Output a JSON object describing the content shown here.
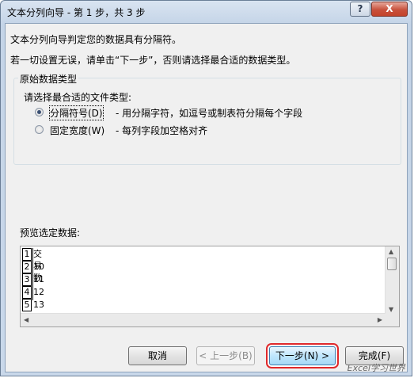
{
  "window": {
    "title": "文本分列向导 - 第 1 步，共 3 步",
    "help_label": "?",
    "close_label": "X"
  },
  "intro": {
    "line1": "文本分列向导判定您的数据具有分隔符。",
    "line2": "若一切设置无误，请单击“下一步”，否则请选择最合适的数据类型。"
  },
  "group": {
    "title": "原始数据类型",
    "prompt": "请选择最合适的文件类型:",
    "options": [
      {
        "label": "分隔符号(D)",
        "description": "- 用分隔字符，如逗号或制表符分隔每个字段",
        "checked": true
      },
      {
        "label": "固定宽度(W)",
        "description": "- 每列字段加空格对齐",
        "checked": false
      }
    ]
  },
  "preview": {
    "label": "预览选定数据:",
    "rows": [
      {
        "num": "1",
        "value": "交易数"
      },
      {
        "num": "2",
        "value": "10"
      },
      {
        "num": "3",
        "value": "11"
      },
      {
        "num": "4",
        "value": "12"
      },
      {
        "num": "5",
        "value": "13"
      }
    ]
  },
  "buttons": {
    "cancel": "取消",
    "back": "< 上一步(B)",
    "next": "下一步(N) >",
    "finish": "完成(F)"
  },
  "watermark": "Excel学习世界",
  "colors": {
    "highlight": "#e0292b",
    "accent": "#3c7fb1"
  }
}
